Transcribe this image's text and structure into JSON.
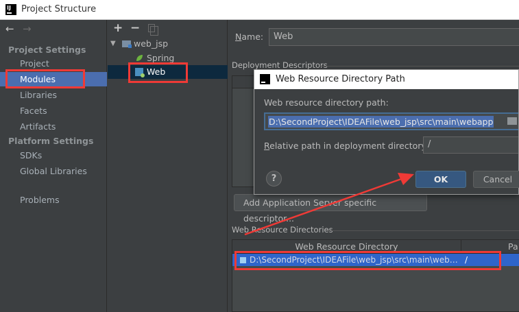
{
  "window": {
    "title": "Project Structure"
  },
  "nav": {
    "back_glyph": "←",
    "forward_glyph": "→",
    "project_settings_header": "Project Settings",
    "platform_settings_header": "Platform Settings",
    "items": {
      "project": "Project",
      "modules": "Modules",
      "libraries": "Libraries",
      "facets": "Facets",
      "artifacts": "Artifacts",
      "sdks": "SDKs",
      "global_libraries": "Global Libraries",
      "problems": "Problems"
    },
    "selected": "Modules"
  },
  "tree": {
    "toolbar": {
      "add": "+",
      "remove": "−"
    },
    "root": "web_jsp",
    "children": [
      "Spring",
      "Web"
    ],
    "selected": "Web"
  },
  "module": {
    "name_label_prefix": "",
    "name_label_mnemonic": "N",
    "name_label_rest": "ame:",
    "name_value": "Web",
    "deployment_descriptors_label": "Deployment Descriptors",
    "add_descriptor_button": "Add Application Server specific descriptor...",
    "web_resource_dirs_label": "Web Resource Directories",
    "resdir_columns": [
      "Web Resource Directory",
      "Pa"
    ],
    "resdir_rows": [
      {
        "directory": "D:\\SecondProject\\IDEAFile\\web_jsp\\src\\main\\weba...",
        "path": "/"
      }
    ]
  },
  "dialog": {
    "title": "Web Resource Directory Path",
    "path_label": "Web resource directory path:",
    "path_value": "D:\\SecondProject\\IDEAFile\\web_jsp\\src\\main\\webapp",
    "relative_label_mnemonic": "R",
    "relative_label_rest": "elative path in deployment directory:",
    "relative_value": "/",
    "help": "?",
    "ok": "OK",
    "cancel": "Cancel"
  },
  "colors": {
    "background": "#3c3f41",
    "selection": "#4b6eaf",
    "highlight": "#ef3a36"
  }
}
